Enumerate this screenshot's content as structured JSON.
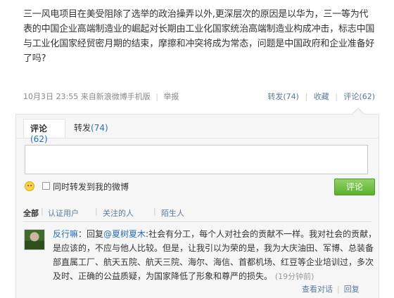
{
  "post": {
    "text": "三一风电项目在美受阻除了选举的政治操弄以外,更深层次的原因是以华为，三一等为代表的中国企业高端制造业的崛起对长期由工业化国家统治高端制造业构成冲击，标志中国与工业化国家经贸密月期的结束，摩擦和冲突将成为常态，问题是中国政府和企业准备好了吗?",
    "timestamp": "10月3日 23:55",
    "source": "来自新浪微博手机版",
    "report": "举报",
    "repost": "转发(74)",
    "favorite": "收藏",
    "comment": "评论(62)"
  },
  "comment_panel": {
    "tab_comment_label": "评论",
    "tab_comment_count": "(62)",
    "tab_repost_label": "转发",
    "tab_repost_count": "(74)",
    "also_repost_label": "同时转发到我的微博",
    "submit_label": "评论",
    "filters": {
      "all": "全部",
      "verified": "认证用户",
      "following": "关注的人",
      "strangers": "陌生人"
    }
  },
  "comments": [
    {
      "user": "反行嘛",
      "reply_prefix": "：回复",
      "mention": "@夏树夏木",
      "text": ":社会有分工，每个人对社会的贡献不一样。我对社会的贡献，是应该的，不应与他人比较。但是，让我引以为荣的是，我为大庆油田、军博、总装备部直属工厂、航天五院、航天三院、海尔、海信、首都机场、红豆等企业培训过，多次及时、正确的公益质疑，为国家降低了形象和尊严的损失。",
      "time": "(19分钟前)",
      "view_conversation": "查看对话",
      "reply": "回复"
    }
  ]
}
